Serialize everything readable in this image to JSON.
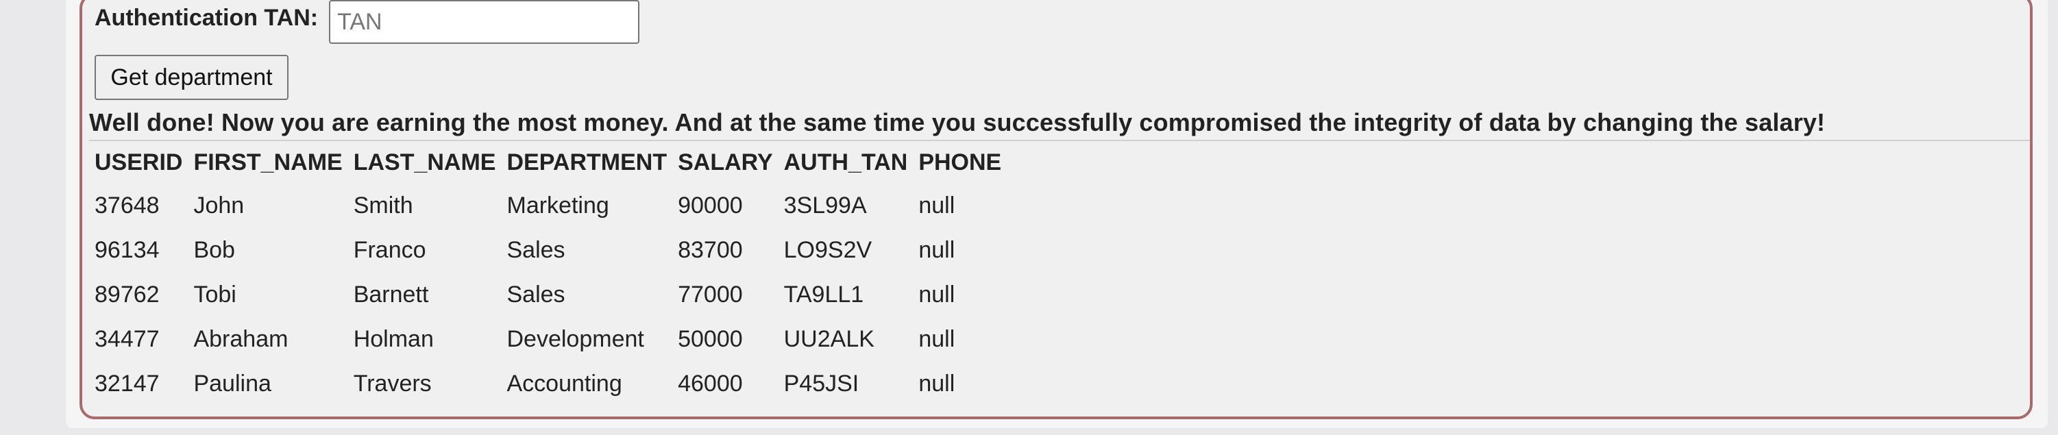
{
  "form": {
    "tan_label": "Authentication TAN:",
    "tan_placeholder": "TAN",
    "tan_value": "",
    "button_label": "Get department"
  },
  "feedback": {
    "message": "Well done! Now you are earning the most money. And at the same time you successfully compromised the integrity of data by changing the salary!"
  },
  "table": {
    "columns": [
      "USERID",
      "FIRST_NAME",
      "LAST_NAME",
      "DEPARTMENT",
      "SALARY",
      "AUTH_TAN",
      "PHONE"
    ],
    "rows": [
      [
        "37648",
        "John",
        "Smith",
        "Marketing",
        "90000",
        "3SL99A",
        "null"
      ],
      [
        "96134",
        "Bob",
        "Franco",
        "Sales",
        "83700",
        "LO9S2V",
        "null"
      ],
      [
        "89762",
        "Tobi",
        "Barnett",
        "Sales",
        "77000",
        "TA9LL1",
        "null"
      ],
      [
        "34477",
        "Abraham",
        "Holman",
        "Development",
        "50000",
        "UU2ALK",
        "null"
      ],
      [
        "32147",
        "Paulina",
        "Travers",
        "Accounting",
        "46000",
        "P45JSI",
        "null"
      ]
    ]
  },
  "colors": {
    "border_accent": "#a86a6a",
    "panel_background": "#f0f0f0",
    "page_background": "#e9e9ec"
  }
}
